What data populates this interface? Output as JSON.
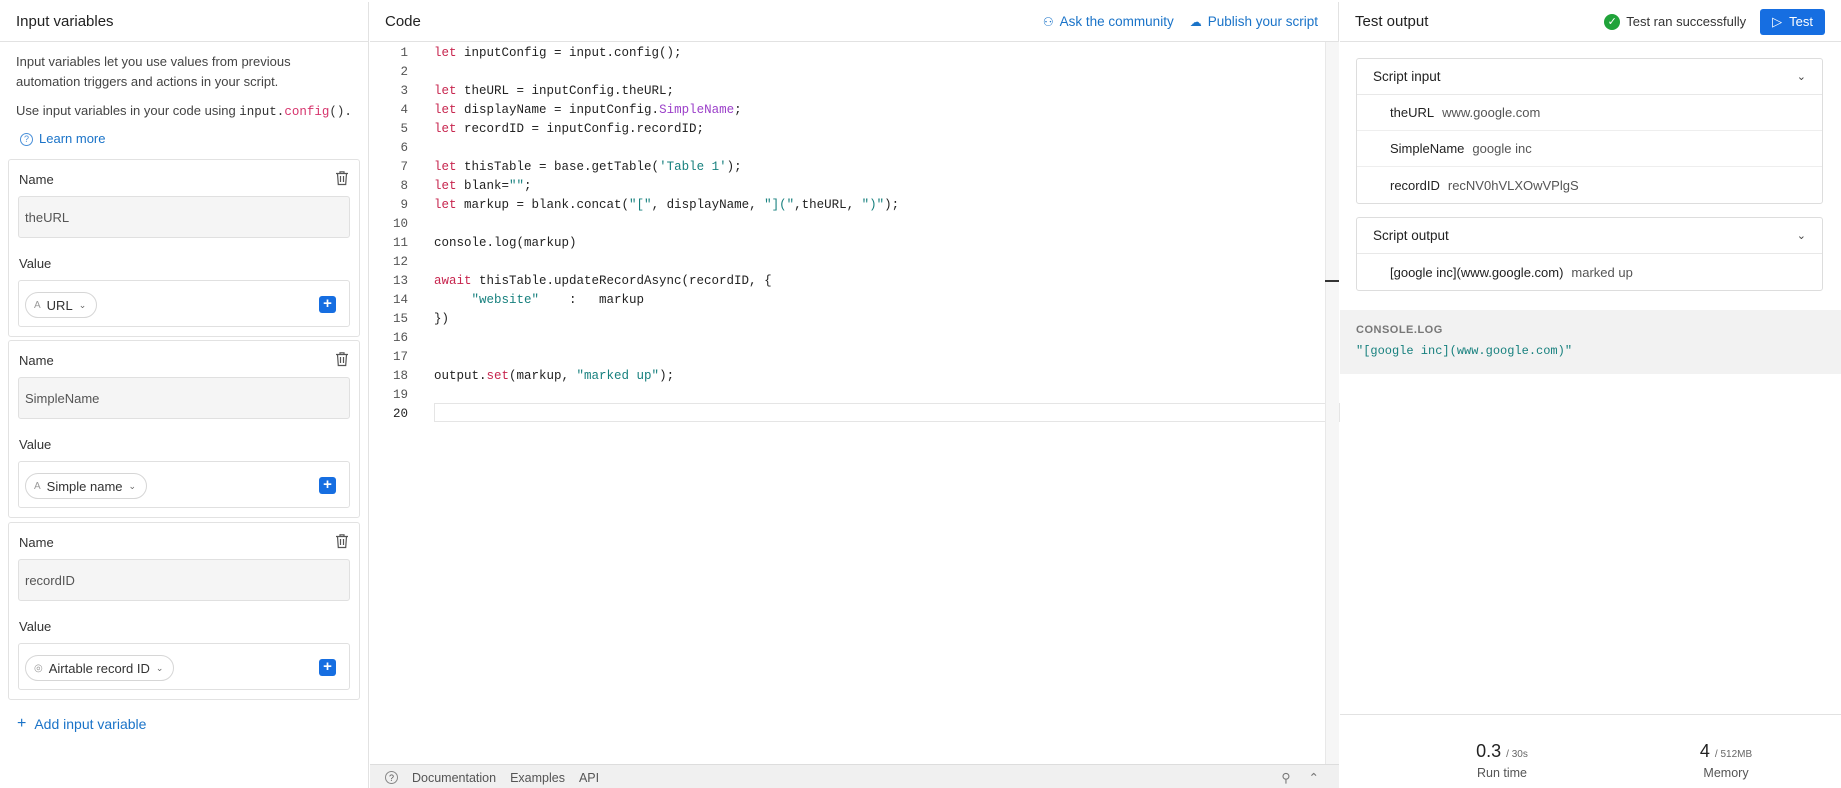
{
  "left": {
    "title": "Input variables",
    "desc1": "Input variables let you use values from previous automation triggers and actions in your script.",
    "desc2_prefix": "Use input variables in your code using ",
    "desc2_code_a": "input.",
    "desc2_code_b": "config",
    "desc2_code_c": "().",
    "learn_more": "Learn more",
    "name_label": "Name",
    "value_label": "Value",
    "variables": [
      {
        "name": "theURL",
        "value": "URL",
        "type_icon": "text-type-icon"
      },
      {
        "name": "SimpleName",
        "value": "Simple name",
        "type_icon": "text-type-icon"
      },
      {
        "name": "recordID",
        "value": "Airtable record ID",
        "type_icon": "record-id-icon"
      }
    ],
    "add_variable": "Add input variable"
  },
  "code": {
    "title": "Code",
    "ask_community": "Ask the community",
    "publish": "Publish your script",
    "bottom_tabs": [
      "Documentation",
      "Examples",
      "API"
    ]
  },
  "test": {
    "title": "Test output",
    "status": "Test ran successfully",
    "test_button": "Test",
    "script_input_title": "Script input",
    "inputs": [
      {
        "k": "theURL",
        "v": "www.google.com"
      },
      {
        "k": "SimpleName",
        "v": "google inc"
      },
      {
        "k": "recordID",
        "v": "recNV0hVLXOwVPlgS"
      }
    ],
    "script_output_title": "Script output",
    "outputs": [
      {
        "k": "[google inc](www.google.com)",
        "v": "marked up"
      }
    ],
    "console_title": "CONSOLE.LOG",
    "console_output": "\"[google inc](www.google.com)\"",
    "runtime": "0.3",
    "runtime_limit": "/ 30s",
    "runtime_label": "Run time",
    "memory": "4",
    "memory_limit": "/ 512MB",
    "memory_label": "Memory"
  },
  "colors": {
    "accent": "#166ee1",
    "success": "#20a33a",
    "keyword": "#c7254e",
    "string": "#17807e",
    "property": "#9b3fc9"
  }
}
